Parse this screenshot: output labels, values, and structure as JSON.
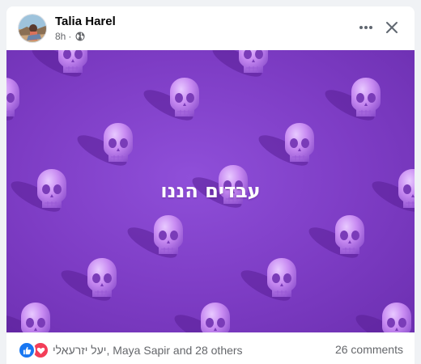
{
  "post": {
    "author": "Talia Harel",
    "time": "8h",
    "separator": "·",
    "privacy_icon": "globe-icon",
    "more_icon": "more-horizontal-icon",
    "close_icon": "close-icon"
  },
  "photo": {
    "caption": "עבדים הננו",
    "background_color": "#7d3cc4",
    "pattern_icon": "skull-icon"
  },
  "footer": {
    "reaction_icons": [
      "like-icon",
      "love-icon"
    ],
    "reaction_name_1": "יעל יזרעאלי",
    "reaction_rest": ", Maya Sapir and 28 others",
    "comments": "26 comments"
  },
  "colors": {
    "like": "#1877f2",
    "love": "#f33e58",
    "text_secondary": "#65676b"
  }
}
